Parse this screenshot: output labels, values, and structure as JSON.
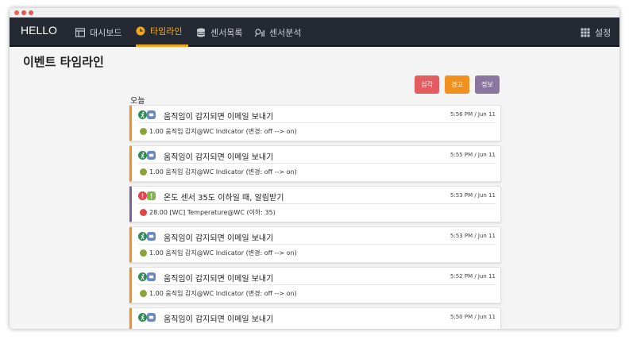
{
  "app": {
    "brand": "HELLO"
  },
  "nav": {
    "items": [
      {
        "label": "대시보드",
        "icon": "dashboard-icon"
      },
      {
        "label": "타임라인",
        "icon": "clock-icon",
        "active": true
      },
      {
        "label": "센서목록",
        "icon": "database-icon"
      },
      {
        "label": "센서분석",
        "icon": "analytics-icon"
      }
    ],
    "settings_label": "설정",
    "settings_icon": "grid-icon"
  },
  "page": {
    "title": "이벤트 타임라인",
    "day_label": "오늘"
  },
  "filters": {
    "critical": "심각",
    "warning": "경고",
    "info": "정보",
    "colors": {
      "critical": "#e35d60",
      "warning": "#f0901e",
      "info": "#8b76a0"
    }
  },
  "events": [
    {
      "level": "warning",
      "title": "움직임이 감지되면 이메일 보내기",
      "time": "5:56 PM / Jun 11",
      "detail": "1.00 움직임 감지@WC Indicator (변경: off --> on)"
    },
    {
      "level": "warning",
      "title": "움직임이 감지되면 이메일 보내기",
      "time": "5:55 PM / Jun 11",
      "detail": "1.00 움직임 감지@WC Indicator (변경: off --> on)"
    },
    {
      "level": "critical",
      "title": "온도 센서 35도 이하일 때, 알림받기",
      "time": "5:53 PM / Jun 11",
      "detail": "28.00 [WC] Temperature@WC (이하: 35)"
    },
    {
      "level": "warning",
      "title": "움직임이 감지되면 이메일 보내기",
      "time": "5:53 PM / Jun 11",
      "detail": "1.00 움직임 감지@WC Indicator (변경: off --> on)"
    },
    {
      "level": "warning",
      "title": "움직임이 감지되면 이메일 보내기",
      "time": "5:52 PM / Jun 11",
      "detail": "1.00 움직임 감지@WC Indicator (변경: off --> on)"
    },
    {
      "level": "warning",
      "title": "움직임이 감지되면 이메일 보내기",
      "time": "5:50 PM / Jun 11",
      "detail": ""
    }
  ]
}
